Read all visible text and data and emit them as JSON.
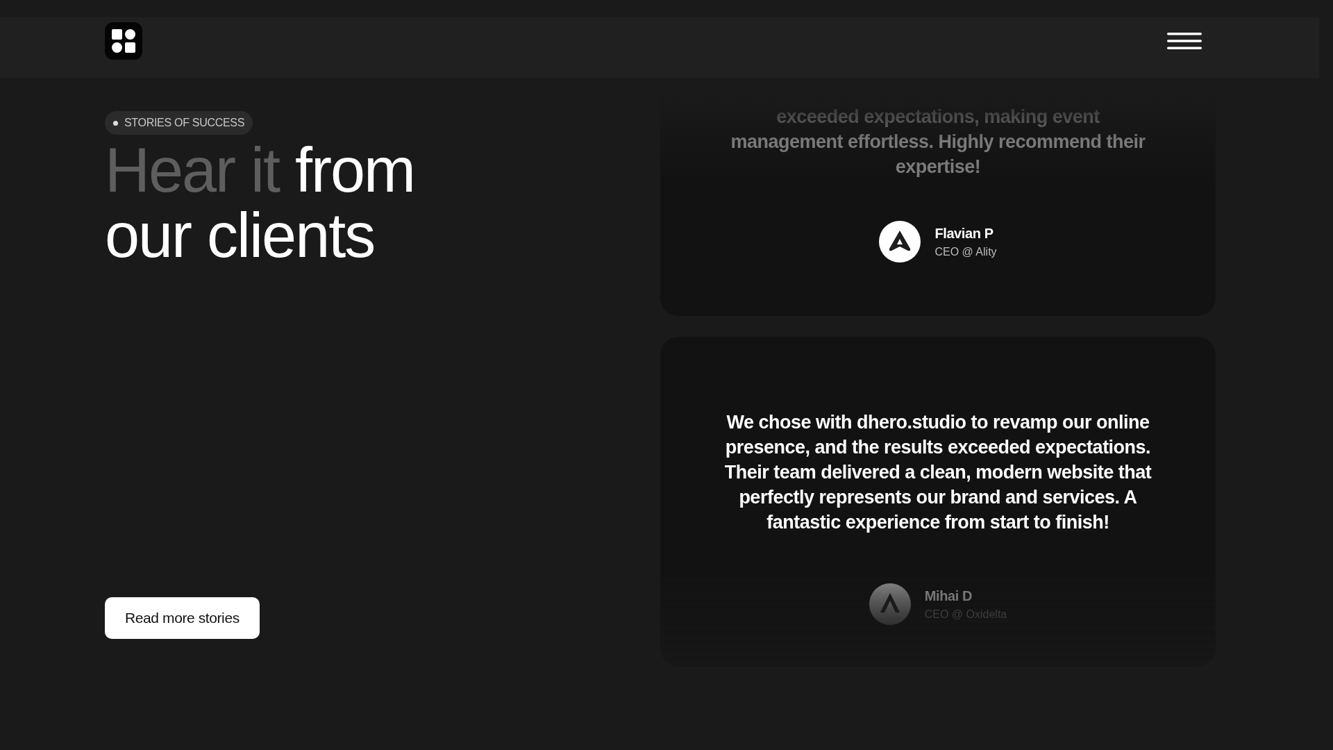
{
  "badge": "STORIES OF SUCCESS",
  "heading": {
    "muted": "Hear it",
    "text": "from our clients"
  },
  "button": "Read more stories",
  "testimonials": [
    {
      "kind": "upper",
      "quote": "exceeded expectations, making event management effortless. Highly recommend their expertise!",
      "name": "Flavian P",
      "role": "CEO @ Ality"
    },
    {
      "kind": "lower",
      "quote": "We chose with dhero.studio to revamp our online presence, and the results exceeded expectations. Their team delivered a clean, modern website that perfectly represents our brand and services. A fantastic experience from start to finish!",
      "name": "Mihai D",
      "role": "CEO @ Oxidelta"
    }
  ]
}
